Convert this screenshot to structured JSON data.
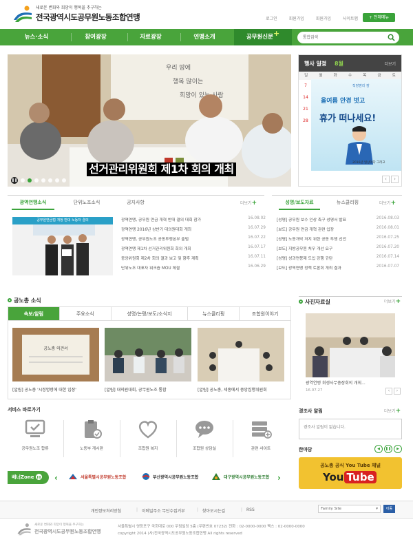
{
  "header": {
    "logo_sub": "새로운 변화와 희망이 행복을 추구하는",
    "logo_main": "전국광역시도공무원노동조합연맹",
    "links": [
      "로그인",
      "회원가입",
      "회원가입",
      "사이트맵"
    ],
    "sitemap_button": "+ 전체메뉴"
  },
  "nav": {
    "items": [
      "뉴스·소식",
      "참여광장",
      "자료광장",
      "연맹소개"
    ],
    "special": "공무원신문",
    "search_placeholder": "통합검색"
  },
  "main_visual": {
    "caption": "선거관리위원회 제1차 회의 개최"
  },
  "calendar": {
    "title": "행사 일정",
    "month": "8월",
    "more": "더보기",
    "weekdays": [
      "일",
      "월",
      "화",
      "수",
      "목",
      "금",
      "토"
    ],
    "days": [
      "7",
      "14",
      "21",
      "28"
    ],
    "ad_brand": "직장맘리 잠",
    "ad_line1": "올여름 안경 벗고",
    "ad_line2": "휴가 떠나세요!",
    "ad_small": "2016년 일상이다 그리고"
  },
  "news": {
    "tabs": [
      "광역연맹소식",
      "단위노조소식",
      "공지사항"
    ],
    "more": "더보기",
    "thumb_head": "공무원연금법 개정 반대 노동자 결의",
    "rows": [
      {
        "title": "광역연맹, 공무원 연금 개혁 반대 결의 대회 참가",
        "date": "16.08.02"
      },
      {
        "title": "광역연맹 2016년 상반기 대의원대회 개최",
        "date": "16.07.29"
      },
      {
        "title": "광역연맹, 공무원노조 공동투쟁본부 출범",
        "date": "16.07.22"
      },
      {
        "title": "광역연맹 제1차 선거관리위원회 회의 개최",
        "date": "16.07.17"
      },
      {
        "title": "중앙위원회 제2차 회의 결과 보고 및 향후 계획",
        "date": "16.07.11"
      },
      {
        "title": "단위노조 대표자 워크숍 MOU 체결",
        "date": "16.06.29"
      }
    ]
  },
  "press": {
    "tabs": [
      "성명/보도자료",
      "뉴스클리핑"
    ],
    "more": "더보기",
    "rows": [
      {
        "title": "[성명] 공무원 보수 인상 촉구 성명서 발표",
        "date": "2016.08.03"
      },
      {
        "title": "[보도] 공무원 연금 개혁 관련 입장",
        "date": "2016.08.01"
      },
      {
        "title": "[성명] 노동개악 저지 위한 공동 투쟁 선언",
        "date": "2016.07.25"
      },
      {
        "title": "[보도] 지방공무원 처우 개선 요구",
        "date": "2016.07.20"
      },
      {
        "title": "[성명] 성과연봉제 도입 강행 규탄",
        "date": "2016.07.14"
      },
      {
        "title": "[보도] 광역연맹 정책 토론회 개최 결과",
        "date": "2016.07.07"
      }
    ]
  },
  "gong": {
    "title": "공노총 소식",
    "tabs": [
      "속보/알림",
      "주요소식",
      "성명/논평/보도/소식지",
      "뉴스클리핑",
      "조합원이야기"
    ],
    "cards": [
      {
        "caption": "[알림] 공노총 '시정명령에 대한 입장'"
      },
      {
        "caption": "[알림] 대의원대회, 공무원노조 통합"
      },
      {
        "caption": "[알림] 공노총, 세종에서 중앙집행위원회"
      }
    ]
  },
  "photo": {
    "title": "사진자료실",
    "more": "더보기",
    "caption": "광역연맹 회생사무총장회의 개최...",
    "date": "16.07.27"
  },
  "service": {
    "title": "서비스 바로가기",
    "items": [
      "공무원노조 합류",
      "노동부 게시판",
      "조합원 복지",
      "조합원 상담실",
      "관련 사이트"
    ]
  },
  "alarm": {
    "title": "경조사 알림",
    "more": "더보기",
    "empty": "경조사 알림이 없습니다."
  },
  "hanmadang": {
    "title": "한마당",
    "yt_top": "공노총 공식 You Tube 채널",
    "yt_you": "You",
    "yt_tube": "Tube"
  },
  "banner": {
    "label": "배너Zone",
    "items": [
      "서울특별시공무원노동조합",
      "부산광역시공무원노동조합",
      "대구광역시공무원노동조합"
    ]
  },
  "footer": {
    "links": [
      "개인정보처리방침",
      "이메일주소 무단수집거부",
      "찾아오시는길",
      "RSS"
    ],
    "family_site": "Family Site",
    "go": "이동",
    "logo_sub": "새로운 변화와 희망이 행복을 추구하는",
    "logo_main": "전국광역시도공무원노동조합연맹",
    "addr": "서울특별시 영등포구 국회대로 000 우림빌딩 5층 (우편번호 07232)   전화 : 02-0000-0000   팩스 : 02-0000-0000",
    "copy": "copyright 2014 (사)전국광역시도공무원노동조합연맹 All rights reserved"
  },
  "colors": {
    "brand_green": "#49a43b",
    "dark_green": "#2f8a2c",
    "youtube_red": "#d82121"
  }
}
